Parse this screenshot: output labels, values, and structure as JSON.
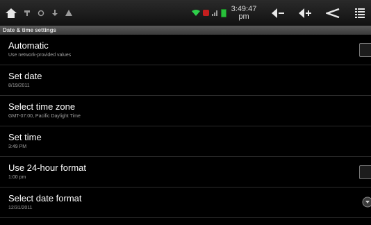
{
  "status_bar": {
    "time": "3:49:47",
    "ampm": "pm"
  },
  "header": {
    "title": "Date & time settings"
  },
  "settings": [
    {
      "title": "Automatic",
      "subtitle": "Use network-provided values"
    },
    {
      "title": "Set date",
      "subtitle": "8/19/2011"
    },
    {
      "title": "Select time zone",
      "subtitle": "GMT-07:00, Pacific Daylight Time"
    },
    {
      "title": "Set time",
      "subtitle": "3:49 PM"
    },
    {
      "title": "Use 24-hour format",
      "subtitle": "1:00 pm"
    },
    {
      "title": "Select date format",
      "subtitle": "12/31/2011"
    }
  ],
  "colors": {
    "background": "#000000",
    "header_background": "#4a4a4a",
    "battery": "#28c03a"
  }
}
